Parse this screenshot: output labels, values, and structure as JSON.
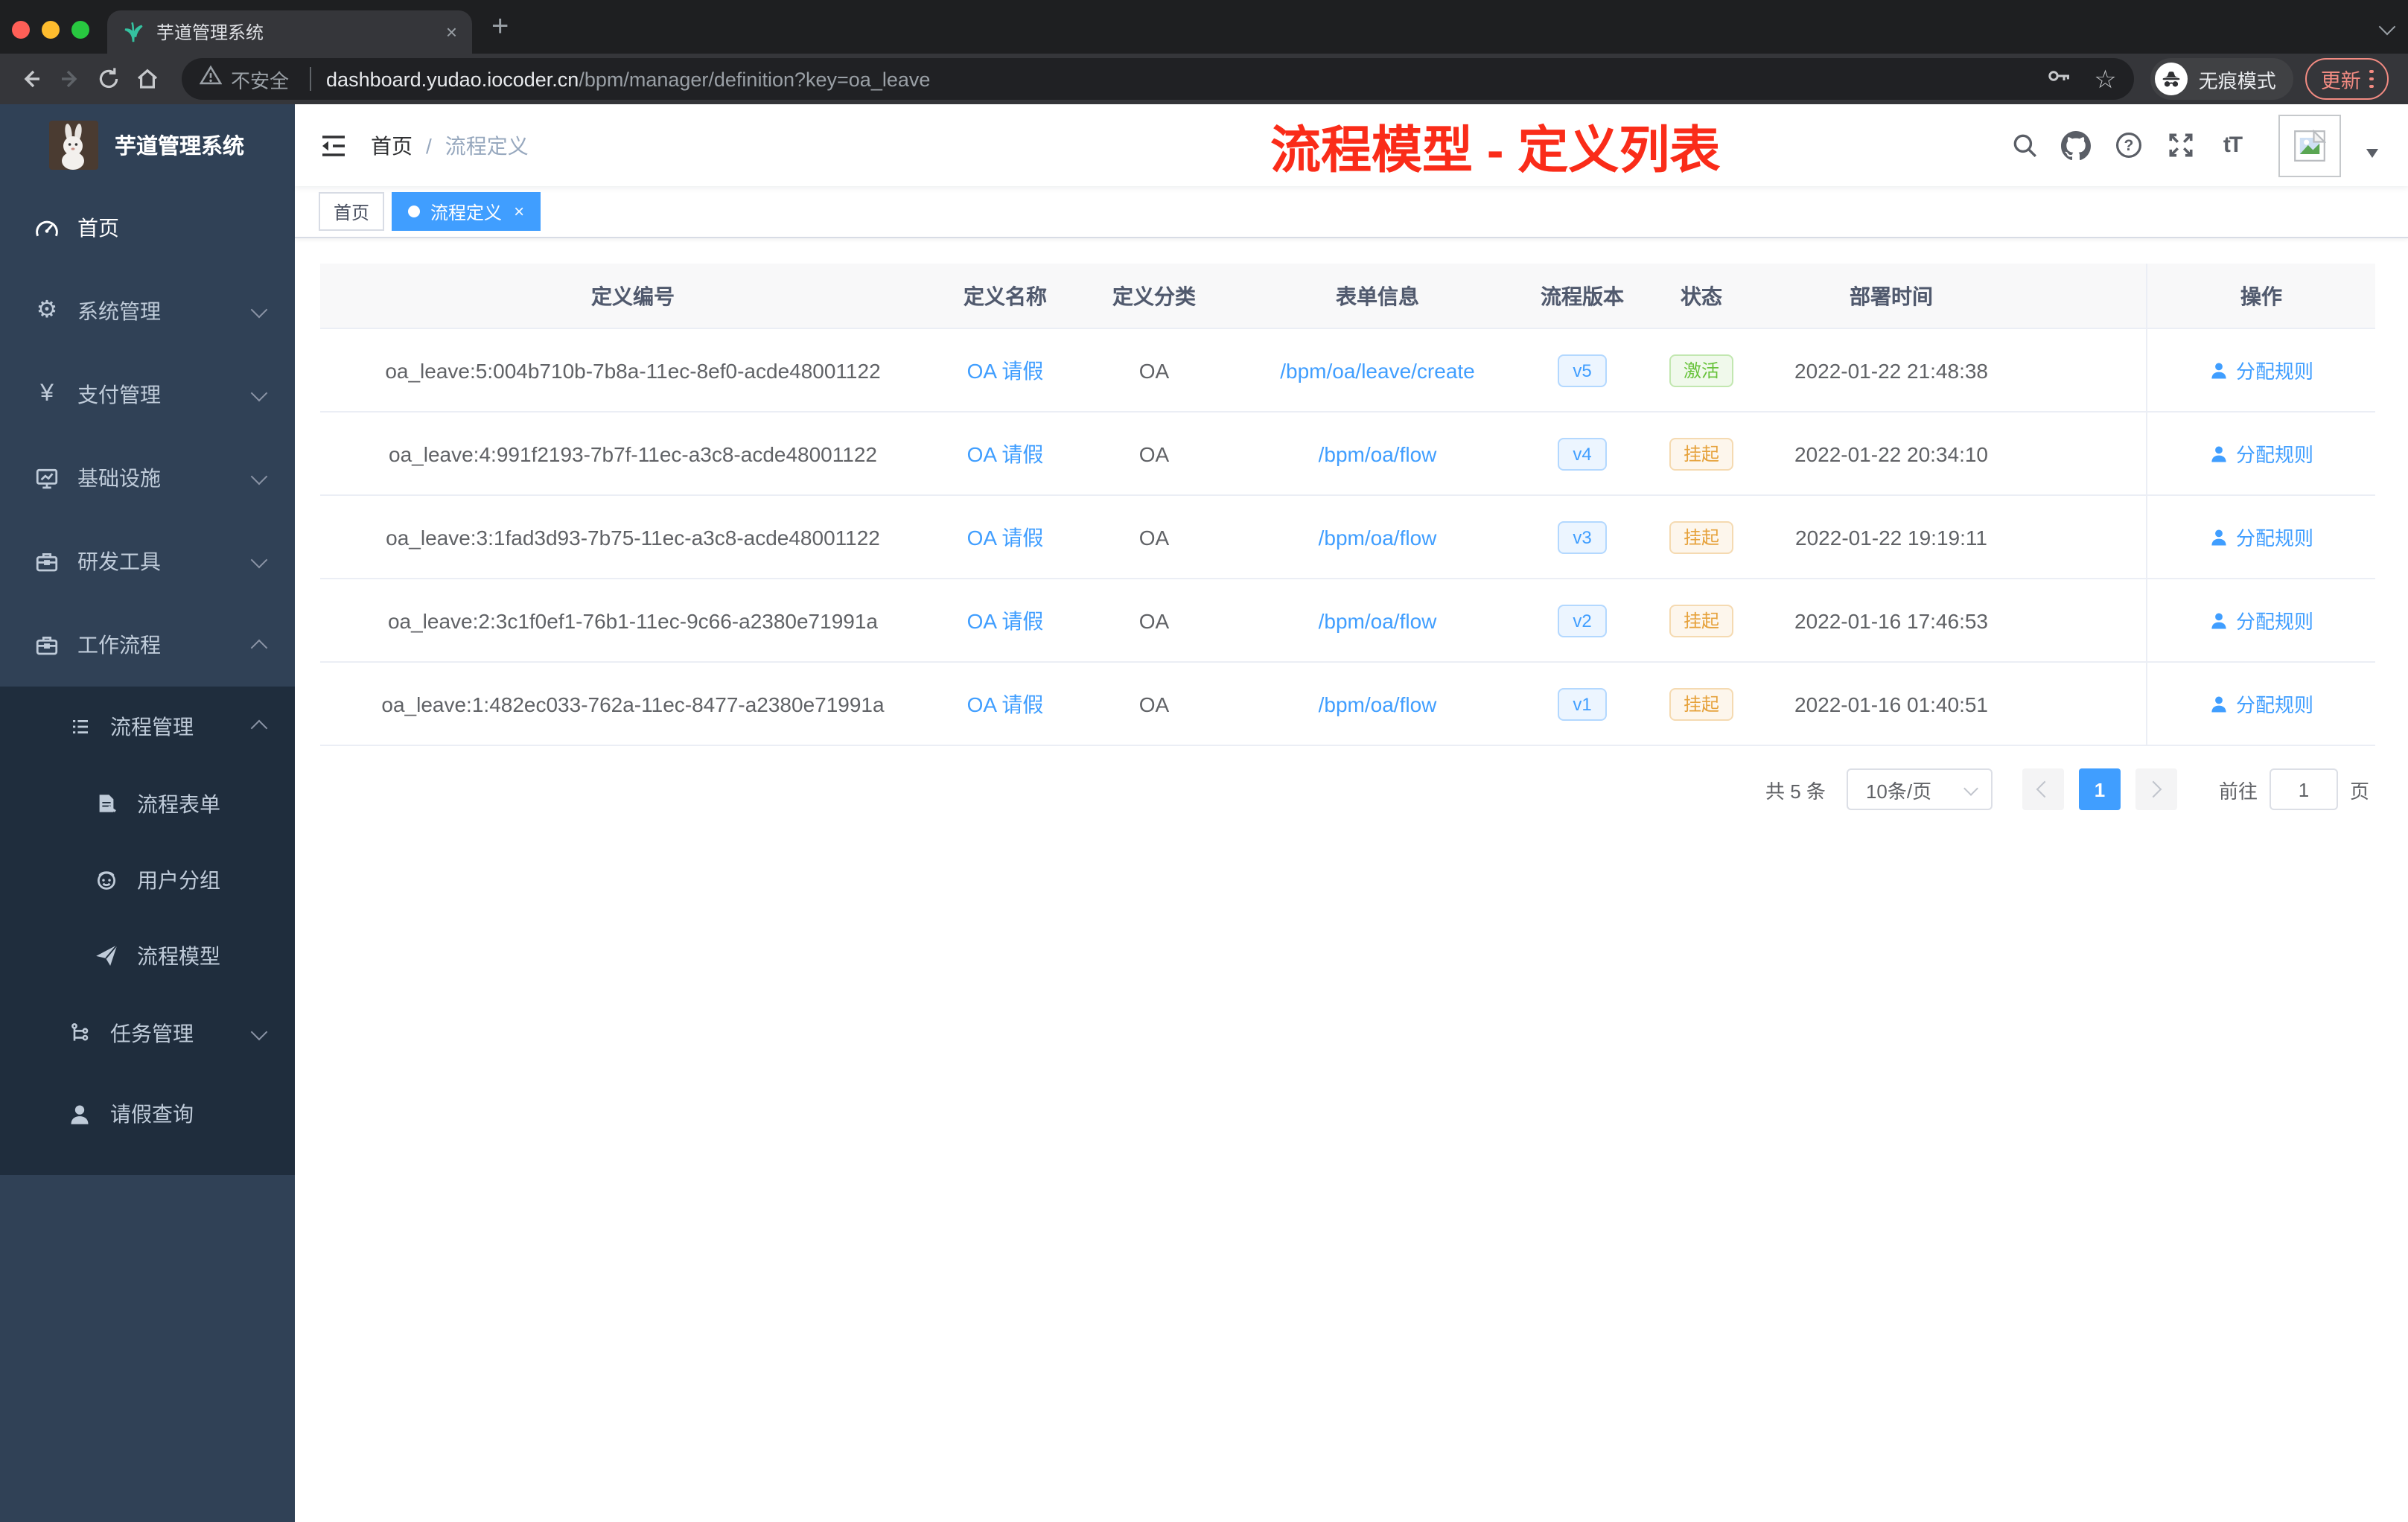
{
  "browser": {
    "tab_title": "芋道管理系统",
    "tab_close": "×",
    "new_tab": "+",
    "security_label": "不安全",
    "url_domain": "dashboard.yudao.iocoder.cn",
    "url_path": "/bpm/manager/definition?key=oa_leave",
    "bookmark_star": "☆",
    "incognito_label": "无痕模式",
    "update_label": "更新"
  },
  "navbar": {
    "breadcrumb_home": "首页",
    "breadcrumb_separator": "/",
    "breadcrumb_current": "流程定义",
    "annotation": "流程模型 - 定义列表",
    "font_icon": "tT"
  },
  "sidebar": {
    "title": "芋道管理系统",
    "items": [
      {
        "label": "首页"
      },
      {
        "label": "系统管理",
        "glyph": "⚙"
      },
      {
        "label": "支付管理",
        "glyph": "¥"
      },
      {
        "label": "基础设施"
      },
      {
        "label": "研发工具"
      },
      {
        "label": "工作流程"
      },
      {
        "label": "流程管理"
      },
      {
        "label": "流程表单"
      },
      {
        "label": "用户分组"
      },
      {
        "label": "流程模型"
      },
      {
        "label": "任务管理"
      },
      {
        "label": "请假查询"
      }
    ]
  },
  "tags": {
    "home": "首页",
    "active": "流程定义",
    "close": "×"
  },
  "table": {
    "columns": [
      "定义编号",
      "定义名称",
      "定义分类",
      "表单信息",
      "流程版本",
      "状态",
      "部署时间",
      "操作"
    ],
    "action_label": "分配规则",
    "rows": [
      {
        "id": "oa_leave:5:004b710b-7b8a-11ec-8ef0-acde48001122",
        "name": "OA 请假",
        "category": "OA",
        "form": "/bpm/oa/leave/create",
        "version": "v5",
        "status": "激活",
        "status_type": "success",
        "time": "2022-01-22 21:48:38"
      },
      {
        "id": "oa_leave:4:991f2193-7b7f-11ec-a3c8-acde48001122",
        "name": "OA 请假",
        "category": "OA",
        "form": "/bpm/oa/flow",
        "version": "v4",
        "status": "挂起",
        "status_type": "warning",
        "time": "2022-01-22 20:34:10"
      },
      {
        "id": "oa_leave:3:1fad3d93-7b75-11ec-a3c8-acde48001122",
        "name": "OA 请假",
        "category": "OA",
        "form": "/bpm/oa/flow",
        "version": "v3",
        "status": "挂起",
        "status_type": "warning",
        "time": "2022-01-22 19:19:11"
      },
      {
        "id": "oa_leave:2:3c1f0ef1-76b1-11ec-9c66-a2380e71991a",
        "name": "OA 请假",
        "category": "OA",
        "form": "/bpm/oa/flow",
        "version": "v2",
        "status": "挂起",
        "status_type": "warning",
        "time": "2022-01-16 17:46:53"
      },
      {
        "id": "oa_leave:1:482ec033-762a-11ec-8477-a2380e71991a",
        "name": "OA 请假",
        "category": "OA",
        "form": "/bpm/oa/flow",
        "version": "v1",
        "status": "挂起",
        "status_type": "warning",
        "time": "2022-01-16 01:40:51"
      }
    ]
  },
  "pagination": {
    "total": "共 5 条",
    "page_size": "10条/页",
    "current_page": "1",
    "goto_label": "前往",
    "goto_value": "1",
    "unit_label": "页"
  },
  "colors": {
    "primary": "#409eff",
    "success": "#67c23a",
    "warning": "#e6a23c",
    "annotation_red": "#fa2c19",
    "sidebar_bg": "#304156",
    "submenu_bg": "#1f2d3d",
    "update_red": "#f28b82"
  }
}
